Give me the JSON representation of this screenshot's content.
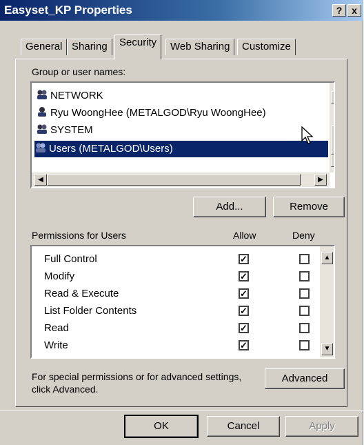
{
  "window": {
    "title": "Easyset_KP Properties",
    "help_label": "?",
    "close_label": "x"
  },
  "tabs": [
    {
      "label": "General"
    },
    {
      "label": "Sharing"
    },
    {
      "label": "Security"
    },
    {
      "label": "Web Sharing"
    },
    {
      "label": "Customize"
    }
  ],
  "security": {
    "group_label": "Group or user names:",
    "users": [
      {
        "name": "NETWORK",
        "icon": "group-icon"
      },
      {
        "name": "Ryu WoongHee (METALGOD\\Ryu WoongHee)",
        "icon": "user-icon"
      },
      {
        "name": "SYSTEM",
        "icon": "group-icon"
      },
      {
        "name": "Users (METALGOD\\Users)",
        "icon": "group-icon",
        "selected": true
      }
    ],
    "add_label": "Add...",
    "remove_label": "Remove",
    "permissions_label": "Permissions for Users",
    "allow_label": "Allow",
    "deny_label": "Deny",
    "permissions": [
      {
        "name": "Full Control",
        "allow": true,
        "deny": false
      },
      {
        "name": "Modify",
        "allow": true,
        "deny": false
      },
      {
        "name": "Read & Execute",
        "allow": true,
        "deny": false
      },
      {
        "name": "List Folder Contents",
        "allow": true,
        "deny": false
      },
      {
        "name": "Read",
        "allow": true,
        "deny": false
      },
      {
        "name": "Write",
        "allow": true,
        "deny": false
      }
    ],
    "special_line1": "For special permissions or for advanced settings,",
    "special_line2": "click Advanced.",
    "advanced_label": "Advanced"
  },
  "footer": {
    "ok_label": "OK",
    "cancel_label": "Cancel",
    "apply_label": "Apply"
  },
  "colors": {
    "selection": "#0a246a",
    "face": "#d4d0c8"
  }
}
